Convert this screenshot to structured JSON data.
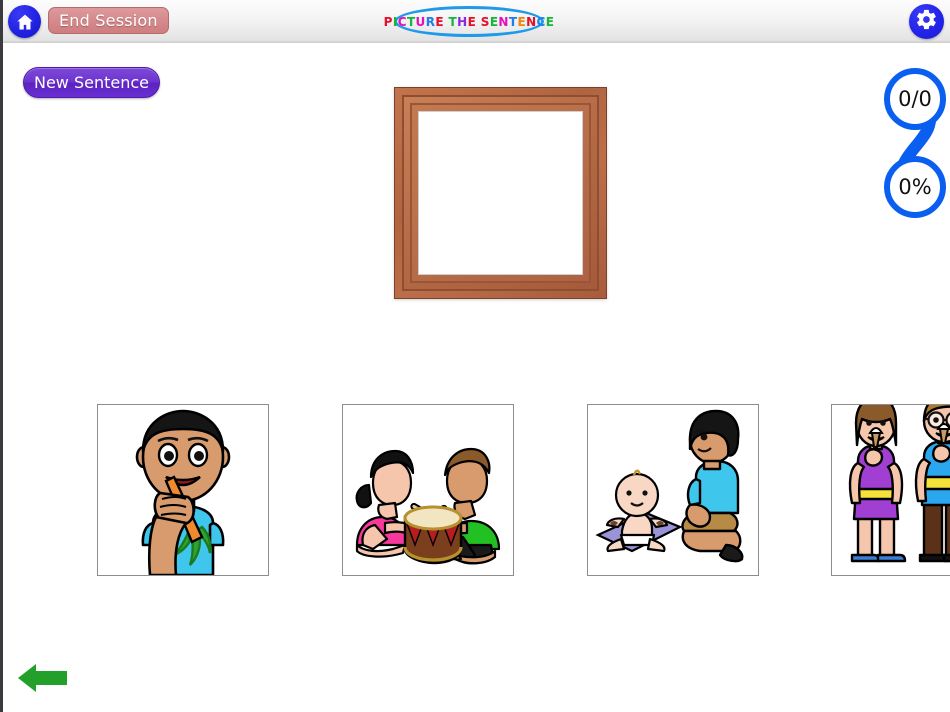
{
  "app": {
    "title_word_letters": [
      {
        "ch": "P",
        "color": "#e8102a"
      },
      {
        "ch": "I",
        "color": "#16b93a"
      },
      {
        "ch": "C",
        "color": "#e80fc0"
      },
      {
        "ch": "T",
        "color": "#16b93a"
      },
      {
        "ch": "U",
        "color": "#e80fc0"
      },
      {
        "ch": "R",
        "color": "#1f7ff0"
      },
      {
        "ch": "E",
        "color": "#e8102a"
      },
      {
        "ch": " ",
        "color": "#000000"
      },
      {
        "ch": "T",
        "color": "#16b93a"
      },
      {
        "ch": "H",
        "color": "#8a2be2"
      },
      {
        "ch": "E",
        "color": "#e8102a"
      },
      {
        "ch": " ",
        "color": "#000000"
      },
      {
        "ch": "S",
        "color": "#e8102a"
      },
      {
        "ch": "E",
        "color": "#16b93a"
      },
      {
        "ch": "N",
        "color": "#e80fc0"
      },
      {
        "ch": "T",
        "color": "#1f7ff0"
      },
      {
        "ch": "E",
        "color": "#f08a12"
      },
      {
        "ch": "N",
        "color": "#e8102a"
      },
      {
        "ch": "C",
        "color": "#1f7ff0"
      },
      {
        "ch": "E",
        "color": "#16b93a"
      }
    ],
    "title_plain": "PICTURE THE SENTENCE"
  },
  "toolbar": {
    "home_icon": "home-icon",
    "end_session_label": "End Session",
    "settings_icon": "gear-icon"
  },
  "controls": {
    "new_sentence_label": "New Sentence",
    "back_arrow_icon": "arrow-left-icon"
  },
  "score": {
    "ratio": "0/0",
    "percent": "0%",
    "outline_color": "#0a5ff0"
  },
  "frame": {
    "name": "picture-frame",
    "content": "",
    "frame_color": "#b06440"
  },
  "cards": [
    {
      "id": "card-1",
      "alt": "boy-eating-carrot"
    },
    {
      "id": "card-2",
      "alt": "two-children-playing-drum"
    },
    {
      "id": "card-3",
      "alt": "baby-on-mat-with-boy-kneeling"
    },
    {
      "id": "card-4",
      "alt": "girl-and-boy-eating-ice-cream"
    }
  ],
  "colors": {
    "accent_blue": "#1e9ae8",
    "button_purple": "#6d33d0",
    "end_session_red": "#d58a8c",
    "arrow_green": "#22a02a",
    "icon_blue": "#2222e8"
  }
}
